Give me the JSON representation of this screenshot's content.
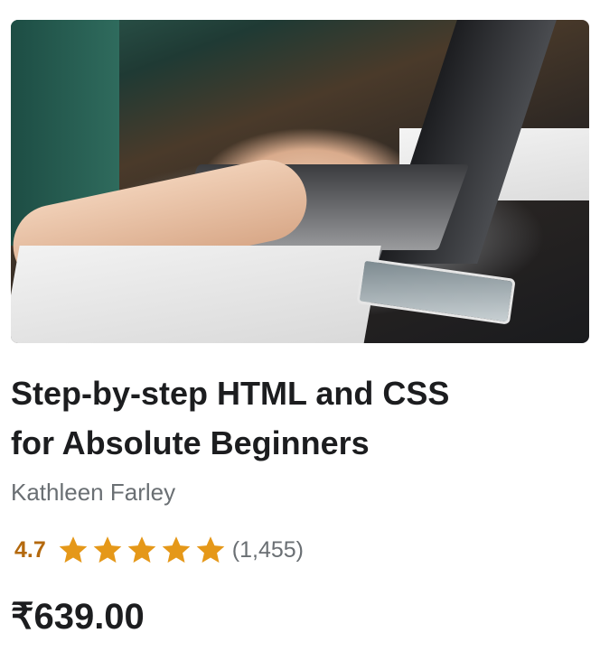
{
  "course": {
    "image_alt": "Person typing on a laptop",
    "title_line1": "Step-by-step HTML and CSS",
    "title_line2": "for Absolute Beginners",
    "author": "Kathleen Farley",
    "rating": "4.7",
    "rating_value": 4.7,
    "rating_max": 5,
    "review_count": "(1,455)",
    "price": "₹639.00",
    "star_icon": "star-icon"
  },
  "colors": {
    "rating": "#b4690e",
    "star": "#e59819",
    "text": "#1c1d1f",
    "muted": "#6a6f73"
  }
}
